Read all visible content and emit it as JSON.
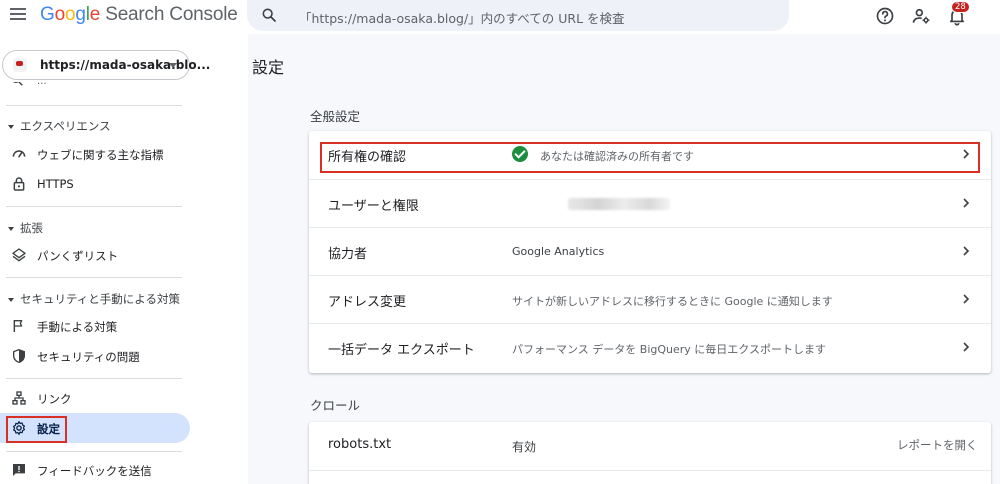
{
  "header": {
    "logo_google": [
      "G",
      "o",
      "o",
      "g",
      "l",
      "e"
    ],
    "logo_product": "Search Console",
    "search_placeholder": "「https://mada-osaka.blog/」内のすべての URL を検査",
    "notification_count": "28"
  },
  "sidebar": {
    "property_url": "https://mada-osaka.blo...",
    "clipped_item_label": "...",
    "sections": [
      {
        "title": "エクスペリエンス",
        "items": [
          {
            "label": "ウェブに関する主な指標",
            "icon": "gauge-icon"
          },
          {
            "label": "HTTPS",
            "icon": "lock-icon"
          }
        ]
      },
      {
        "title": "拡張",
        "items": [
          {
            "label": "パンくずリスト",
            "icon": "layers-icon"
          }
        ]
      },
      {
        "title": "セキュリティと手動による対策",
        "items": [
          {
            "label": "手動による対策",
            "icon": "flag-icon"
          },
          {
            "label": "セキュリティの問題",
            "icon": "shield-icon"
          }
        ]
      }
    ],
    "links_label": "リンク",
    "settings_label": "設定",
    "feedback_label": "フィードバックを送信"
  },
  "main": {
    "page_title": "設定",
    "general": {
      "title": "全般設定",
      "rows": [
        {
          "name": "所有権の確認",
          "value": "あなたは確認済みの所有者です"
        },
        {
          "name": "ユーザーと権限",
          "value": ""
        },
        {
          "name": "協力者",
          "value": "Google Analytics"
        },
        {
          "name": "アドレス変更",
          "value": "サイトが新しいアドレスに移行するときに Google に通知します"
        },
        {
          "name": "一括データ エクスポート",
          "value": "パフォーマンス データを BigQuery に毎日エクスポートします"
        }
      ]
    },
    "crawl": {
      "title": "クロール",
      "rows": [
        {
          "name": "robots.txt",
          "value": "有効",
          "action": "レポートを開く"
        }
      ]
    }
  },
  "colors": {
    "accent_active": "#d3e3fd",
    "highlight_box": "#d93025",
    "verified_green": "#1e8e3e",
    "badge_red": "#c5221f"
  }
}
